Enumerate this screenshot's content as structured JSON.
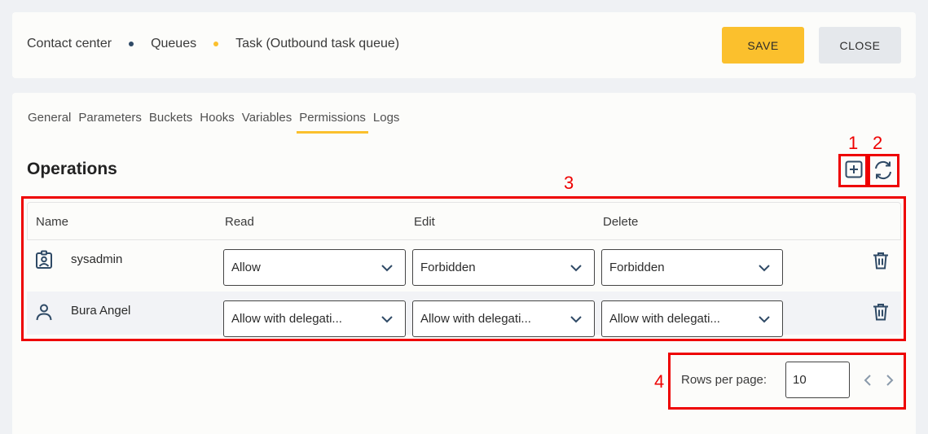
{
  "header": {
    "breadcrumb": [
      "Contact center",
      "Queues",
      "Task (Outbound task queue)"
    ],
    "save_label": "SAVE",
    "close_label": "CLOSE"
  },
  "tabs": [
    "General",
    "Parameters",
    "Buckets",
    "Hooks",
    "Variables",
    "Permissions",
    "Logs"
  ],
  "active_tab": "Permissions",
  "section_title": "Operations",
  "table": {
    "columns": [
      "Name",
      "Read",
      "Edit",
      "Delete"
    ],
    "rows": [
      {
        "name": "sysadmin",
        "icon": "role-badge-icon",
        "read": "Allow",
        "edit": "Forbidden",
        "delete": "Forbidden"
      },
      {
        "name": "Bura Angel",
        "icon": "user-icon",
        "read": "Allow with delegati...",
        "edit": "Allow with delegati...",
        "delete": "Allow with delegati..."
      }
    ]
  },
  "pagination": {
    "rows_per_page_label": "Rows per page:",
    "rows_per_page_value": "10"
  },
  "annotations": [
    "1",
    "2",
    "3",
    "4"
  ],
  "colors": {
    "accent": "#fbc02d",
    "annotation": "#ee0000",
    "crumb_dot_1": "#2f4a66",
    "crumb_dot_2": "#fbc02d",
    "icon": "#2f4a66"
  }
}
